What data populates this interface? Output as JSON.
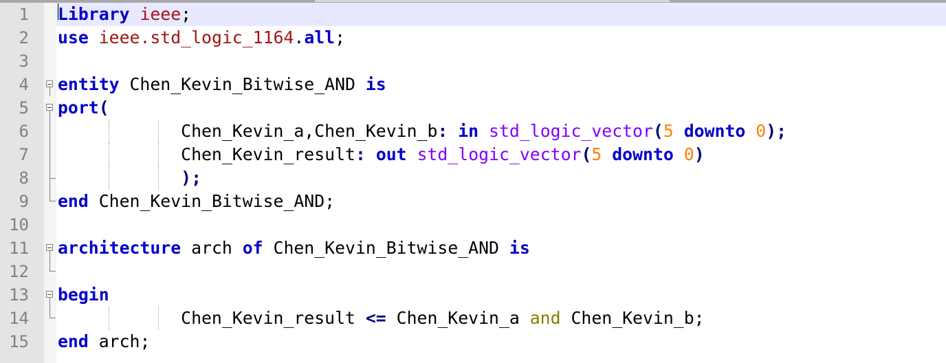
{
  "editor": {
    "language": "VHDL",
    "current_line": 1,
    "lines": [
      {
        "n": "1",
        "tokens": [
          {
            "t": "Library",
            "c": "kw"
          },
          {
            "t": " ",
            "c": ""
          },
          {
            "t": "ieee",
            "c": "lib"
          },
          {
            "t": ";",
            "c": ""
          }
        ]
      },
      {
        "n": "2",
        "tokens": [
          {
            "t": "use",
            "c": "kw"
          },
          {
            "t": " ",
            "c": ""
          },
          {
            "t": "ieee.std_logic_1164",
            "c": "lib"
          },
          {
            "t": ".",
            "c": ""
          },
          {
            "t": "all",
            "c": "kw"
          },
          {
            "t": ";",
            "c": ""
          }
        ]
      },
      {
        "n": "3",
        "tokens": []
      },
      {
        "n": "4",
        "tokens": [
          {
            "t": "entity",
            "c": "kw"
          },
          {
            "t": " Chen_Kevin_Bitwise_AND ",
            "c": ""
          },
          {
            "t": "is",
            "c": "kw"
          }
        ]
      },
      {
        "n": "5",
        "tokens": [
          {
            "t": "port",
            "c": "kw"
          },
          {
            "t": "(",
            "c": "op"
          }
        ]
      },
      {
        "n": "6",
        "tokens": [
          {
            "t": "            Chen_Kevin_a,Chen_Kevin_b",
            "c": ""
          },
          {
            "t": ":",
            "c": "op"
          },
          {
            "t": " ",
            "c": ""
          },
          {
            "t": "in",
            "c": "kw"
          },
          {
            "t": " ",
            "c": ""
          },
          {
            "t": "std_logic_vector",
            "c": "ty"
          },
          {
            "t": "(",
            "c": "op"
          },
          {
            "t": "5",
            "c": "num"
          },
          {
            "t": " ",
            "c": ""
          },
          {
            "t": "downto",
            "c": "kw"
          },
          {
            "t": " ",
            "c": ""
          },
          {
            "t": "0",
            "c": "num"
          },
          {
            "t": ");",
            "c": "op"
          }
        ]
      },
      {
        "n": "7",
        "tokens": [
          {
            "t": "            Chen_Kevin_result",
            "c": ""
          },
          {
            "t": ":",
            "c": "op"
          },
          {
            "t": " ",
            "c": ""
          },
          {
            "t": "out",
            "c": "kw"
          },
          {
            "t": " ",
            "c": ""
          },
          {
            "t": "std_logic_vector",
            "c": "ty"
          },
          {
            "t": "(",
            "c": "op"
          },
          {
            "t": "5",
            "c": "num"
          },
          {
            "t": " ",
            "c": ""
          },
          {
            "t": "downto",
            "c": "kw"
          },
          {
            "t": " ",
            "c": ""
          },
          {
            "t": "0",
            "c": "num"
          },
          {
            "t": ")",
            "c": "op"
          }
        ]
      },
      {
        "n": "8",
        "tokens": [
          {
            "t": "            ",
            "c": ""
          },
          {
            "t": ");",
            "c": "op"
          }
        ]
      },
      {
        "n": "9",
        "tokens": [
          {
            "t": "end",
            "c": "kw"
          },
          {
            "t": " Chen_Kevin_Bitwise_AND;",
            "c": ""
          }
        ]
      },
      {
        "n": "10",
        "tokens": []
      },
      {
        "n": "11",
        "tokens": [
          {
            "t": "architecture",
            "c": "kw"
          },
          {
            "t": " arch ",
            "c": ""
          },
          {
            "t": "of",
            "c": "kw"
          },
          {
            "t": " Chen_Kevin_Bitwise_AND ",
            "c": ""
          },
          {
            "t": "is",
            "c": "kw"
          }
        ]
      },
      {
        "n": "12",
        "tokens": []
      },
      {
        "n": "13",
        "tokens": [
          {
            "t": "begin",
            "c": "kw"
          }
        ]
      },
      {
        "n": "14",
        "tokens": [
          {
            "t": "            Chen_Kevin_result ",
            "c": ""
          },
          {
            "t": "<=",
            "c": "op"
          },
          {
            "t": " Chen_Kevin_a ",
            "c": ""
          },
          {
            "t": "and",
            "c": "logic"
          },
          {
            "t": " Chen_Kevin_b;",
            "c": ""
          }
        ]
      },
      {
        "n": "15",
        "tokens": [
          {
            "t": "end",
            "c": "kw"
          },
          {
            "t": " arch;",
            "c": ""
          }
        ]
      }
    ]
  },
  "fold_markers": {
    "1": "",
    "2": "",
    "3": "",
    "4": "box",
    "5": "box",
    "6": "line",
    "7": "line",
    "8": "end-mid",
    "9": "end",
    "10": "",
    "11": "box",
    "12": "end",
    "13": "box",
    "14": "end",
    "15": ""
  },
  "indent_guides": {
    "6": [
      158,
      230
    ],
    "7": [
      158,
      230
    ],
    "8": [
      158,
      230
    ],
    "14": [
      158,
      230
    ]
  }
}
